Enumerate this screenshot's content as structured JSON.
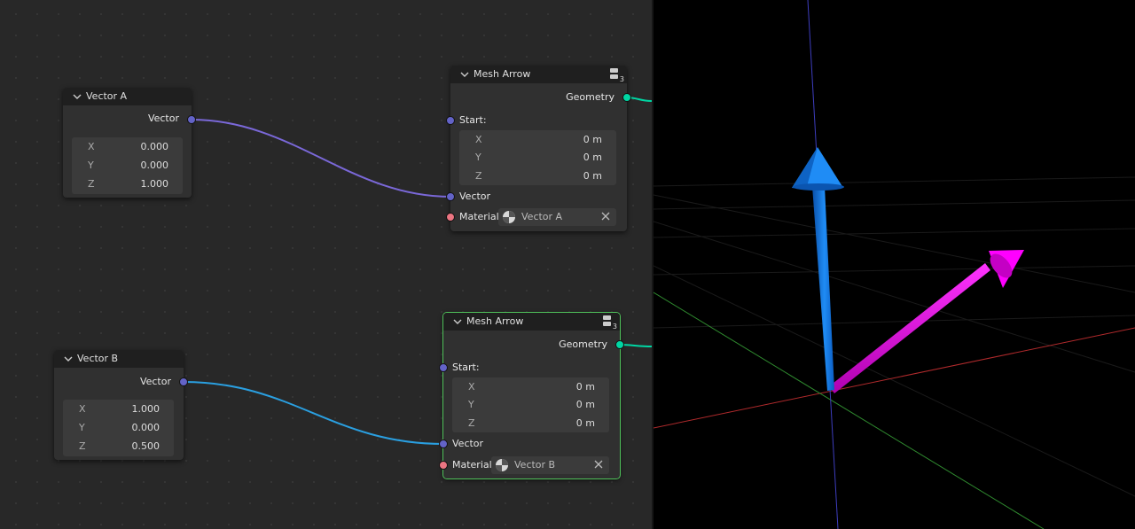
{
  "vector_a": {
    "title": "Vector A",
    "output": "Vector",
    "x_label": "X",
    "x": "0.000",
    "y_label": "Y",
    "y": "0.000",
    "z_label": "Z",
    "z": "1.000"
  },
  "vector_b": {
    "title": "Vector B",
    "output": "Vector",
    "x_label": "X",
    "x": "1.000",
    "y_label": "Y",
    "y": "0.000",
    "z_label": "Z",
    "z": "0.500"
  },
  "mesh_arrow_a": {
    "title": "Mesh Arrow",
    "group_count": "3",
    "output": "Geometry",
    "start_label": "Start:",
    "x_label": "X",
    "x": "0 m",
    "y_label": "Y",
    "y": "0 m",
    "z_label": "Z",
    "z": "0 m",
    "vector_label": "Vector",
    "material_label": "Material:",
    "material": "Vector A"
  },
  "mesh_arrow_b": {
    "title": "Mesh Arrow",
    "group_count": "3",
    "output": "Geometry",
    "start_label": "Start:",
    "x_label": "X",
    "x": "0 m",
    "y_label": "Y",
    "y": "0 m",
    "z_label": "Z",
    "z": "0 m",
    "vector_label": "Vector",
    "material_label": "Material:",
    "material": "Vector B"
  },
  "colors": {
    "link_a": "#7a68d8",
    "link_b": "#2a9fe0",
    "geometry_link": "#00d6a3",
    "selected_outline": "#4fc15a",
    "arrow_a": "#1a7fe8",
    "arrow_b": "#ee00ee",
    "axis_x": "#c8383a",
    "axis_y": "#3fa33f",
    "axis_z": "#4848d0"
  }
}
